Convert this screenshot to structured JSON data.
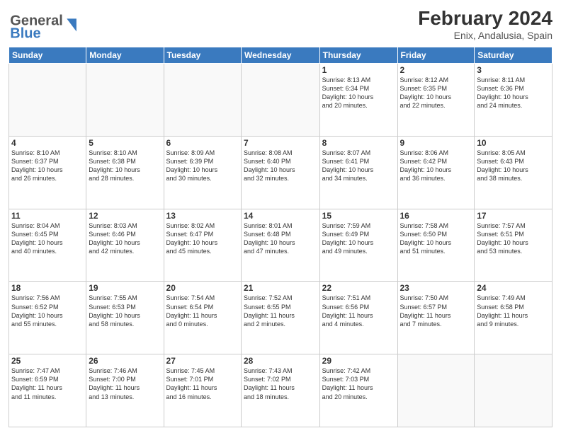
{
  "header": {
    "logo_text_general": "General",
    "logo_text_blue": "Blue",
    "title": "February 2024",
    "subtitle": "Enix, Andalusia, Spain"
  },
  "days_of_week": [
    "Sunday",
    "Monday",
    "Tuesday",
    "Wednesday",
    "Thursday",
    "Friday",
    "Saturday"
  ],
  "weeks": [
    [
      {
        "day": "",
        "info": ""
      },
      {
        "day": "",
        "info": ""
      },
      {
        "day": "",
        "info": ""
      },
      {
        "day": "",
        "info": ""
      },
      {
        "day": "1",
        "info": "Sunrise: 8:13 AM\nSunset: 6:34 PM\nDaylight: 10 hours\nand 20 minutes."
      },
      {
        "day": "2",
        "info": "Sunrise: 8:12 AM\nSunset: 6:35 PM\nDaylight: 10 hours\nand 22 minutes."
      },
      {
        "day": "3",
        "info": "Sunrise: 8:11 AM\nSunset: 6:36 PM\nDaylight: 10 hours\nand 24 minutes."
      }
    ],
    [
      {
        "day": "4",
        "info": "Sunrise: 8:10 AM\nSunset: 6:37 PM\nDaylight: 10 hours\nand 26 minutes."
      },
      {
        "day": "5",
        "info": "Sunrise: 8:10 AM\nSunset: 6:38 PM\nDaylight: 10 hours\nand 28 minutes."
      },
      {
        "day": "6",
        "info": "Sunrise: 8:09 AM\nSunset: 6:39 PM\nDaylight: 10 hours\nand 30 minutes."
      },
      {
        "day": "7",
        "info": "Sunrise: 8:08 AM\nSunset: 6:40 PM\nDaylight: 10 hours\nand 32 minutes."
      },
      {
        "day": "8",
        "info": "Sunrise: 8:07 AM\nSunset: 6:41 PM\nDaylight: 10 hours\nand 34 minutes."
      },
      {
        "day": "9",
        "info": "Sunrise: 8:06 AM\nSunset: 6:42 PM\nDaylight: 10 hours\nand 36 minutes."
      },
      {
        "day": "10",
        "info": "Sunrise: 8:05 AM\nSunset: 6:43 PM\nDaylight: 10 hours\nand 38 minutes."
      }
    ],
    [
      {
        "day": "11",
        "info": "Sunrise: 8:04 AM\nSunset: 6:45 PM\nDaylight: 10 hours\nand 40 minutes."
      },
      {
        "day": "12",
        "info": "Sunrise: 8:03 AM\nSunset: 6:46 PM\nDaylight: 10 hours\nand 42 minutes."
      },
      {
        "day": "13",
        "info": "Sunrise: 8:02 AM\nSunset: 6:47 PM\nDaylight: 10 hours\nand 45 minutes."
      },
      {
        "day": "14",
        "info": "Sunrise: 8:01 AM\nSunset: 6:48 PM\nDaylight: 10 hours\nand 47 minutes."
      },
      {
        "day": "15",
        "info": "Sunrise: 7:59 AM\nSunset: 6:49 PM\nDaylight: 10 hours\nand 49 minutes."
      },
      {
        "day": "16",
        "info": "Sunrise: 7:58 AM\nSunset: 6:50 PM\nDaylight: 10 hours\nand 51 minutes."
      },
      {
        "day": "17",
        "info": "Sunrise: 7:57 AM\nSunset: 6:51 PM\nDaylight: 10 hours\nand 53 minutes."
      }
    ],
    [
      {
        "day": "18",
        "info": "Sunrise: 7:56 AM\nSunset: 6:52 PM\nDaylight: 10 hours\nand 55 minutes."
      },
      {
        "day": "19",
        "info": "Sunrise: 7:55 AM\nSunset: 6:53 PM\nDaylight: 10 hours\nand 58 minutes."
      },
      {
        "day": "20",
        "info": "Sunrise: 7:54 AM\nSunset: 6:54 PM\nDaylight: 11 hours\nand 0 minutes."
      },
      {
        "day": "21",
        "info": "Sunrise: 7:52 AM\nSunset: 6:55 PM\nDaylight: 11 hours\nand 2 minutes."
      },
      {
        "day": "22",
        "info": "Sunrise: 7:51 AM\nSunset: 6:56 PM\nDaylight: 11 hours\nand 4 minutes."
      },
      {
        "day": "23",
        "info": "Sunrise: 7:50 AM\nSunset: 6:57 PM\nDaylight: 11 hours\nand 7 minutes."
      },
      {
        "day": "24",
        "info": "Sunrise: 7:49 AM\nSunset: 6:58 PM\nDaylight: 11 hours\nand 9 minutes."
      }
    ],
    [
      {
        "day": "25",
        "info": "Sunrise: 7:47 AM\nSunset: 6:59 PM\nDaylight: 11 hours\nand 11 minutes."
      },
      {
        "day": "26",
        "info": "Sunrise: 7:46 AM\nSunset: 7:00 PM\nDaylight: 11 hours\nand 13 minutes."
      },
      {
        "day": "27",
        "info": "Sunrise: 7:45 AM\nSunset: 7:01 PM\nDaylight: 11 hours\nand 16 minutes."
      },
      {
        "day": "28",
        "info": "Sunrise: 7:43 AM\nSunset: 7:02 PM\nDaylight: 11 hours\nand 18 minutes."
      },
      {
        "day": "29",
        "info": "Sunrise: 7:42 AM\nSunset: 7:03 PM\nDaylight: 11 hours\nand 20 minutes."
      },
      {
        "day": "",
        "info": ""
      },
      {
        "day": "",
        "info": ""
      }
    ]
  ]
}
